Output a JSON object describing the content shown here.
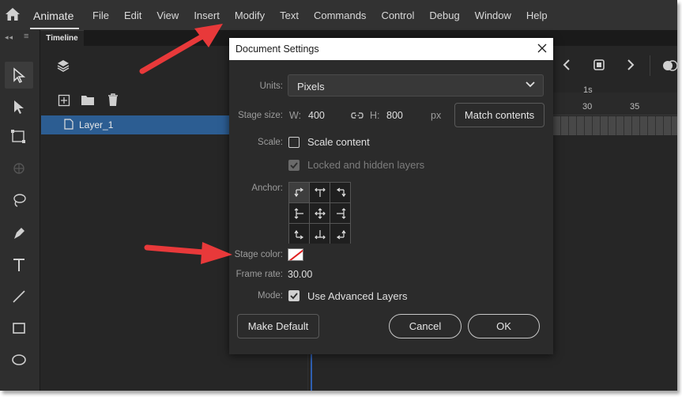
{
  "app": {
    "name": "Animate"
  },
  "menu": [
    "File",
    "Edit",
    "View",
    "Insert",
    "Modify",
    "Text",
    "Commands",
    "Control",
    "Debug",
    "Window",
    "Help"
  ],
  "timeline": {
    "tab_label": "Timeline",
    "layer_name": "Layer_1",
    "ruler_labels": [
      "1s",
      "30",
      "35"
    ]
  },
  "dialog": {
    "title": "Document Settings",
    "units_label": "Units:",
    "units_value": "Pixels",
    "stage_size_label": "Stage size:",
    "w_label": "W:",
    "width": "400",
    "h_label": "H:",
    "height": "800",
    "size_unit": "px",
    "match_contents_label": "Match contents",
    "scale_label": "Scale:",
    "scale_content_label": "Scale content",
    "scale_content_checked": false,
    "locked_hidden_label": "Locked and hidden layers",
    "locked_hidden_checked": true,
    "anchor_label": "Anchor:",
    "stage_color_label": "Stage color:",
    "stage_color": "none",
    "frame_rate_label": "Frame rate:",
    "frame_rate": "30.00",
    "mode_label": "Mode:",
    "advanced_layers_label": "Use Advanced Layers",
    "advanced_layers_checked": true,
    "make_default_label": "Make Default",
    "cancel_label": "Cancel",
    "ok_label": "OK"
  },
  "colors": {
    "annotation_arrow": "#e8393a",
    "selection": "#2c5d92",
    "accent_dark": "#1e1e1e"
  }
}
